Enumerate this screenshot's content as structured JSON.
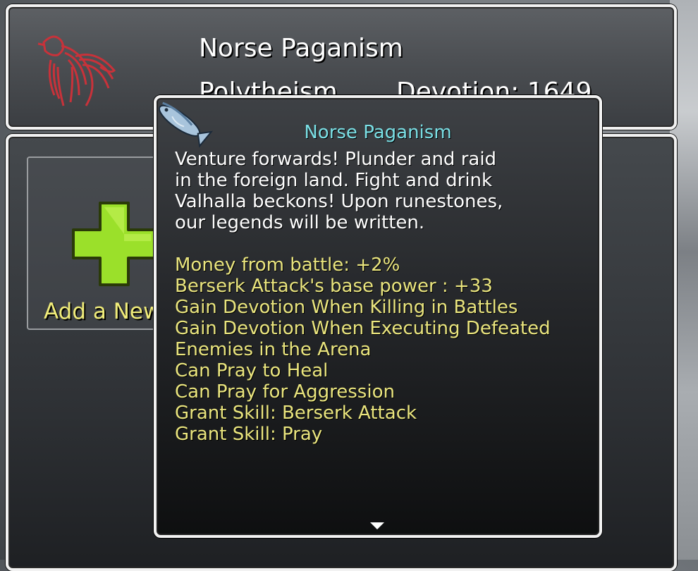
{
  "header": {
    "religion_name": "Norse Paganism",
    "religion_type": "Polytheism",
    "devotion_label": "Devotion: 1649",
    "emblem_icon": "raven-banner-icon"
  },
  "add_slot": {
    "label": "Add a New",
    "icon": "green-plus-icon"
  },
  "tooltip": {
    "icon": "fish-icon",
    "title": "Norse Paganism",
    "description_lines": [
      "Venture forwards! Plunder and raid",
      "in the foreign land. Fight and drink",
      "Valhalla beckons! Upon runestones,",
      "our legends will be written."
    ],
    "effects": [
      "Money from battle: +2%",
      "Berserk Attack's base power : +33",
      "Gain Devotion When Killing in Battles",
      "Gain Devotion When Executing Defeated",
      "Enemies in the Arena",
      "Can Pray to Heal",
      "Can Pray for Aggression",
      "Grant Skill: Berserk Attack",
      "Grant Skill: Pray"
    ],
    "scroll_icon": "scroll-down-arrow-icon"
  },
  "colors": {
    "title_cyan": "#7be0e6",
    "effect_yellow": "#eae57e",
    "add_label_yellow": "#f0ec7a",
    "plus_green": "#9be02a",
    "emblem_red": "#c8323a"
  }
}
